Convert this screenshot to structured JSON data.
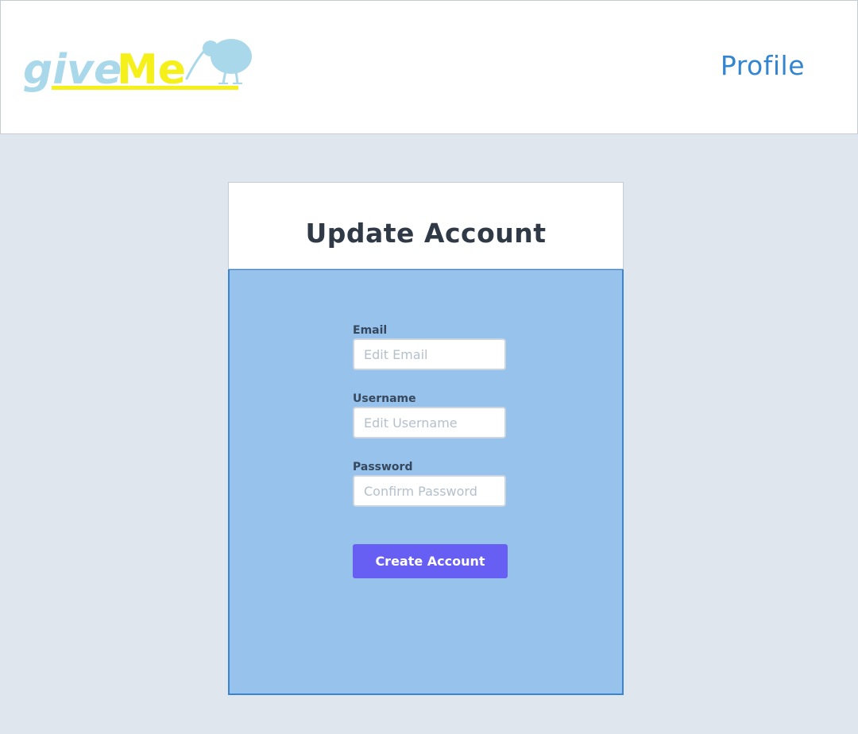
{
  "header": {
    "logo": {
      "text_part1": "give",
      "text_part2": "Me",
      "colors": {
        "give": "#a9d8ea",
        "me": "#f5ef1a",
        "kiwi": "#a9d8ea",
        "underline": "#f5ef1a"
      },
      "icon": "kiwi-bird-icon"
    },
    "nav": {
      "profile_label": "Profile"
    }
  },
  "card": {
    "title": "Update Account",
    "fields": [
      {
        "label": "Email",
        "placeholder": "Edit Email",
        "value": ""
      },
      {
        "label": "Username",
        "placeholder": "Edit Username",
        "value": ""
      },
      {
        "label": "Password",
        "placeholder": "Confirm Password",
        "value": ""
      }
    ],
    "submit_label": "Create Account"
  },
  "colors": {
    "page_background": "#dfe6ee",
    "card_body": "#97c2eb",
    "card_border": "#3a84d6",
    "accent_button": "#675ef4",
    "link": "#3485d0"
  }
}
